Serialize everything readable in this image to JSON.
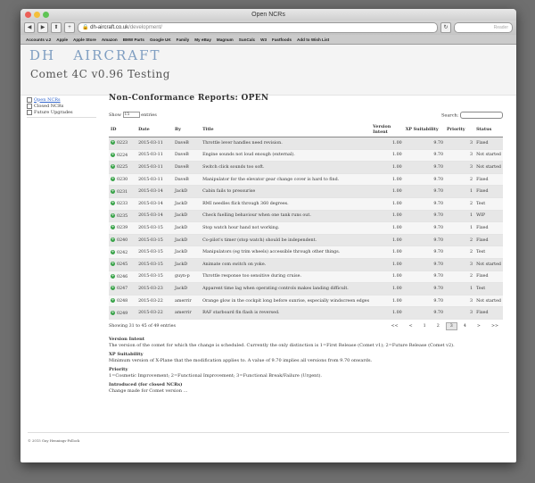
{
  "window": {
    "title": "Open NCRs"
  },
  "toolbar": {
    "url_host": "dh-aircraft.co.uk",
    "url_path": "/development/",
    "search_placeholder": "Reader"
  },
  "bookmarks": [
    "Accounts v.2",
    "Apple",
    "Apple Store",
    "Amazon",
    "BMW Parts",
    "Google UK",
    "Family",
    "My eBay",
    "Magnum",
    "SunCalc",
    "W3",
    "Fastfoods",
    "Add to Wish List"
  ],
  "site": {
    "logo": "DH   AIRCRAFT",
    "subtitle": "Comet 4C v0.96 Testing"
  },
  "sidebar": {
    "items": [
      "Open NCRs",
      "Closed NCRs",
      "Future Upgrades"
    ]
  },
  "page": {
    "heading": "Non-Conformance Reports: OPEN"
  },
  "controls": {
    "show_label": "Show",
    "entries_value": "15",
    "entries_label": "entries",
    "search_label": "Search:"
  },
  "table": {
    "columns": [
      "ID",
      "Date",
      "By",
      "Title",
      "Version Intent",
      "XP Suitability",
      "Priority",
      "Status"
    ],
    "rows": [
      [
        "0223",
        "2015-03-11",
        "DaveB",
        "Throttle lever handles need revision.",
        "1.00",
        "9.70",
        "3",
        "Fixed"
      ],
      [
        "0224",
        "2015-03-11",
        "DaveB",
        "Engine sounds not loud enough (external).",
        "1.00",
        "9.70",
        "3",
        "Not started"
      ],
      [
        "0225",
        "2015-03-11",
        "DaveB",
        "Switch click sounds too soft.",
        "1.00",
        "9.70",
        "3",
        "Not started"
      ],
      [
        "0230",
        "2015-03-11",
        "DaveB",
        "Manipulator for the elevator gear change cover is hard to find.",
        "1.00",
        "9.70",
        "2",
        "Fixed"
      ],
      [
        "0231",
        "2015-03-14",
        "JackD",
        "Cabin fails to pressurise",
        "1.00",
        "9.70",
        "1",
        "Fixed"
      ],
      [
        "0233",
        "2015-03-14",
        "JackD",
        "RMI needles flick through 360 degrees.",
        "1.00",
        "9.70",
        "2",
        "Test"
      ],
      [
        "0235",
        "2015-03-14",
        "JackD",
        "Check fuelling behaviour when one tank runs out.",
        "1.00",
        "9.70",
        "1",
        "WIP"
      ],
      [
        "0239",
        "2015-03-15",
        "JackD",
        "Stop watch hour hand not working.",
        "1.00",
        "9.70",
        "1",
        "Fixed"
      ],
      [
        "0240",
        "2015-03-15",
        "JackD",
        "Co-pilot's timer (stop watch) should be independent.",
        "1.00",
        "9.70",
        "2",
        "Fixed"
      ],
      [
        "0242",
        "2015-03-15",
        "JackD",
        "Manipulators (eg trim wheels) accessible through other things.",
        "1.00",
        "9.70",
        "2",
        "Test"
      ],
      [
        "0245",
        "2015-03-15",
        "JackD",
        "Animate com switch on yoke.",
        "1.00",
        "9.70",
        "3",
        "Not started"
      ],
      [
        "0246",
        "2015-03-15",
        "guyn-p",
        "Throttle response too sensitive during cruise.",
        "1.00",
        "9.70",
        "2",
        "Fixed"
      ],
      [
        "0247",
        "2015-03-23",
        "JackD",
        "Apparent time lag when operating controls makes landing difficult.",
        "1.00",
        "9.70",
        "1",
        "Test"
      ],
      [
        "0248",
        "2015-03-22",
        "amerrir",
        "Orange glow in the cockpit long before sunrise, especially windscreen edges",
        "1.00",
        "9.70",
        "3",
        "Not started"
      ],
      [
        "0249",
        "2015-03-22",
        "amerrir",
        "RAF starboard fin flash is reversed.",
        "1.00",
        "9.70",
        "3",
        "Fixed"
      ]
    ]
  },
  "footer": {
    "info": "Showing 31 to 45 of 49 entries",
    "pages": [
      "<<",
      "<",
      "1",
      "2",
      "3",
      "4",
      ">",
      ">>"
    ],
    "current_page": "3"
  },
  "notes": [
    {
      "title": "Version Intent",
      "text": "The version of the comet for which the change is scheduled. Currently the only distinction is 1=First Release (Comet v1); 2=Future Release (Comet v2)."
    },
    {
      "title": "XP Suitability",
      "text": "Minimum version of X-Plane that the modification applies to. A value of 9.70 implies all versions from 9.70 onwards."
    },
    {
      "title": "Priority",
      "text": "1=Cosmetic Improvement; 2=Functional Improvement; 3=Functional Break/Failure (Urgent)."
    },
    {
      "title": "Introduced (for closed NCRs)",
      "text": "Change made for Comet version ..."
    }
  ],
  "copyright": "© 2015 Guy Hennings-Pollock"
}
